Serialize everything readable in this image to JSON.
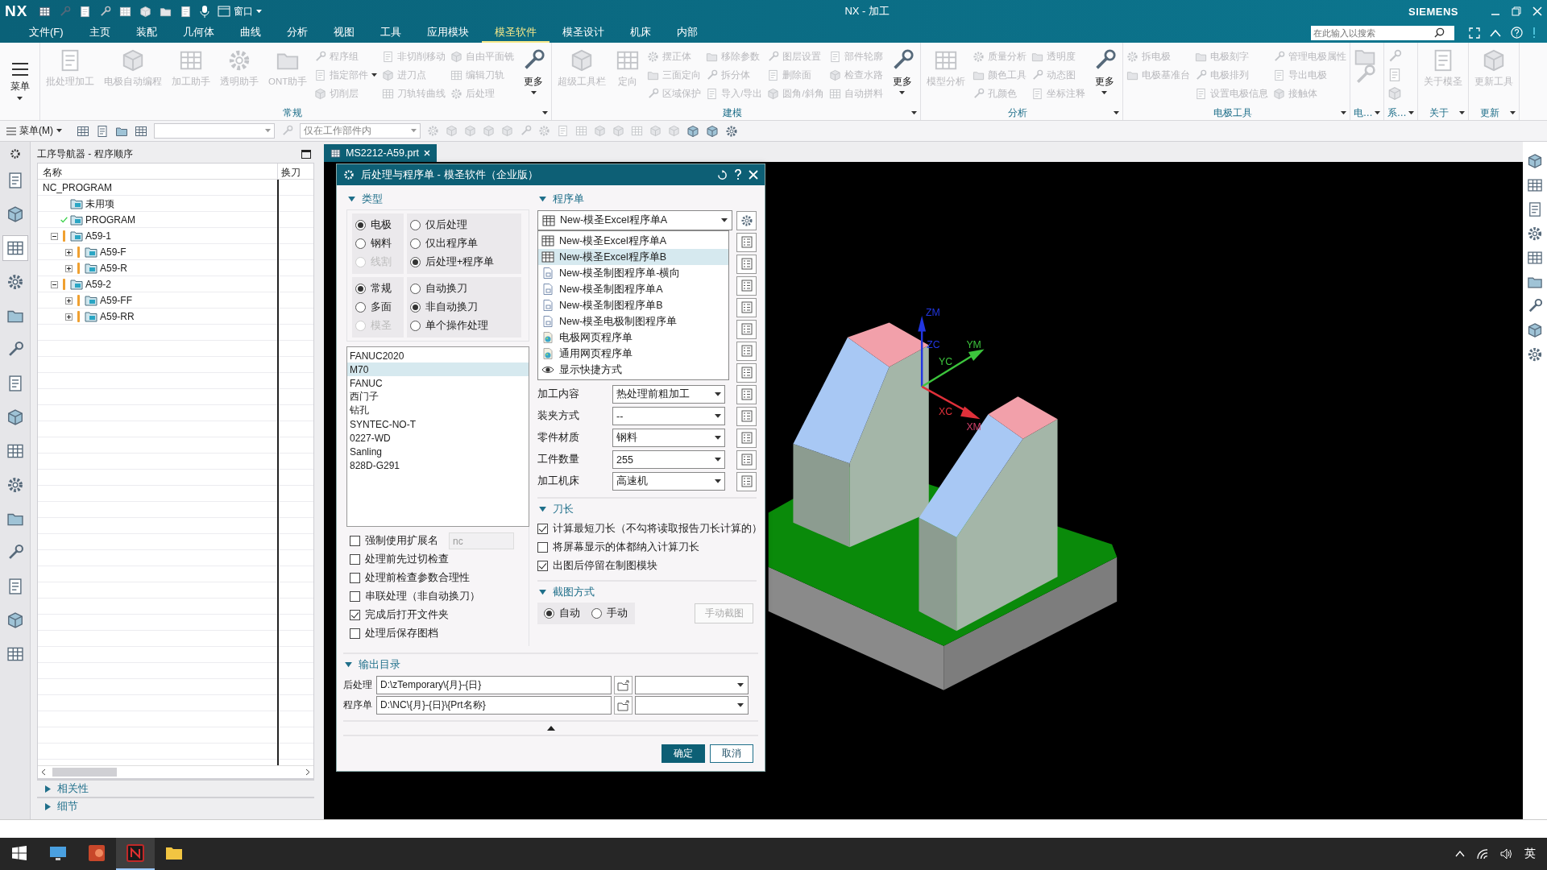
{
  "titlebar": {
    "logo": "NX",
    "window_menu": "窗口",
    "title": "NX - 加工",
    "brand": "SIEMENS"
  },
  "menu_tabs": [
    {
      "label": "文件(F)",
      "selected": false
    },
    {
      "label": "主页",
      "selected": false
    },
    {
      "label": "装配",
      "selected": false
    },
    {
      "label": "几何体",
      "selected": false
    },
    {
      "label": "曲线",
      "selected": false
    },
    {
      "label": "分析",
      "selected": false
    },
    {
      "label": "视图",
      "selected": false
    },
    {
      "label": "工具",
      "selected": false
    },
    {
      "label": "应用模块",
      "selected": false
    },
    {
      "label": "模圣软件",
      "selected": true
    },
    {
      "label": "模圣设计",
      "selected": false
    },
    {
      "label": "机床",
      "selected": false
    },
    {
      "label": "内部",
      "selected": false
    }
  ],
  "search": {
    "placeholder": "在此输入以搜索"
  },
  "ribbon": {
    "menu_button": "菜单",
    "groups": [
      {
        "label": "常规",
        "items": [
          {
            "kind": "large",
            "label": "批处理加工",
            "disabled": true
          },
          {
            "kind": "large",
            "label": "电极自动编程",
            "disabled": true
          },
          {
            "kind": "large",
            "label": "加工助手",
            "disabled": true
          },
          {
            "kind": "large",
            "label": "透明助手",
            "disabled": true
          },
          {
            "kind": "large",
            "label": "ONT助手",
            "disabled": true
          },
          {
            "kind": "column",
            "items": [
              {
                "label": "程序组",
                "disabled": true
              },
              {
                "label": "指定部件",
                "disabled": true,
                "menu": true
              },
              {
                "label": "切削层",
                "disabled": true
              }
            ]
          },
          {
            "kind": "column",
            "items": [
              {
                "label": "非切削移动",
                "disabled": true
              },
              {
                "label": "进刀点",
                "disabled": true
              },
              {
                "label": "刀轨转曲线",
                "disabled": true
              }
            ]
          },
          {
            "kind": "column",
            "items": [
              {
                "label": "自由平面铣",
                "disabled": true
              },
              {
                "label": "编辑刀轨",
                "disabled": true
              },
              {
                "label": "后处理",
                "disabled": true
              }
            ]
          },
          {
            "kind": "more",
            "label": "更多",
            "disabled": false
          }
        ]
      },
      {
        "label": "建模",
        "items": [
          {
            "kind": "large",
            "label": "超级工具栏",
            "disabled": true
          },
          {
            "kind": "large",
            "label": "定向",
            "disabled": true
          },
          {
            "kind": "column",
            "items": [
              {
                "label": "摆正体",
                "disabled": true
              },
              {
                "label": "三面定向",
                "disabled": true
              },
              {
                "label": "区域保护",
                "disabled": true
              }
            ]
          },
          {
            "kind": "column",
            "items": [
              {
                "label": "移除参数",
                "disabled": true
              },
              {
                "label": "拆分体",
                "disabled": true
              },
              {
                "label": "导入/导出",
                "disabled": true
              }
            ]
          },
          {
            "kind": "column",
            "items": [
              {
                "label": "图层设置",
                "disabled": true
              },
              {
                "label": "删除面",
                "disabled": true
              },
              {
                "label": "圆角/斜角",
                "disabled": true
              }
            ]
          },
          {
            "kind": "column",
            "items": [
              {
                "label": "部件轮廓",
                "disabled": true
              },
              {
                "label": "检查水路",
                "disabled": true
              },
              {
                "label": "自动拼料",
                "disabled": true
              }
            ]
          },
          {
            "kind": "more",
            "label": "更多",
            "disabled": false
          }
        ]
      },
      {
        "label": "分析",
        "items": [
          {
            "kind": "large",
            "label": "模型分析",
            "disabled": true
          },
          {
            "kind": "column",
            "items": [
              {
                "label": "质量分析",
                "disabled": true
              },
              {
                "label": "颜色工具",
                "disabled": true
              },
              {
                "label": "孔颜色",
                "disabled": true
              }
            ]
          },
          {
            "kind": "column",
            "items": [
              {
                "label": "透明度",
                "disabled": true
              },
              {
                "label": "动态图",
                "disabled": true
              },
              {
                "label": "坐标注释",
                "disabled": true
              }
            ]
          },
          {
            "kind": "more",
            "label": "更多",
            "disabled": false
          }
        ]
      },
      {
        "label": "电极工具",
        "items": [
          {
            "kind": "column",
            "items": [
              {
                "label": "拆电极",
                "disabled": true
              },
              {
                "label": "电极基准台",
                "disabled": true
              }
            ]
          },
          {
            "kind": "column",
            "items": [
              {
                "label": "电极刻字",
                "disabled": true
              },
              {
                "label": "电极排列",
                "disabled": true
              },
              {
                "label": "设置电极信息",
                "disabled": true
              }
            ]
          },
          {
            "kind": "column",
            "items": [
              {
                "label": "管理电极属性",
                "disabled": true
              },
              {
                "label": "导出电极",
                "disabled": true
              },
              {
                "label": "接触体",
                "disabled": true
              }
            ]
          }
        ]
      },
      {
        "label": "电…",
        "items": [
          {
            "kind": "icons",
            "items": [
              {
                "disabled": true
              },
              {
                "disabled": true
              }
            ]
          }
        ]
      },
      {
        "label": "系…",
        "items": [
          {
            "kind": "icons",
            "items": [
              {
                "disabled": true
              },
              {
                "disabled": true
              },
              {
                "disabled": true
              }
            ]
          }
        ]
      },
      {
        "label": "关于",
        "items": [
          {
            "kind": "large",
            "label": "关于模圣",
            "disabled": true
          }
        ]
      },
      {
        "label": "更新",
        "items": [
          {
            "kind": "large",
            "label": "更新工具",
            "disabled": true
          }
        ]
      }
    ]
  },
  "toolbar": {
    "menu": "菜单(M)",
    "scope": "仅在工作部件内"
  },
  "left_tabs": [
    {
      "selected": false
    },
    {
      "selected": false
    },
    {
      "selected": true
    },
    {
      "selected": false
    },
    {
      "selected": false
    },
    {
      "selected": false
    },
    {
      "selected": false
    },
    {
      "selected": false
    },
    {
      "selected": false
    },
    {
      "selected": false
    },
    {
      "selected": false
    },
    {
      "selected": false
    },
    {
      "selected": false
    },
    {
      "selected": false
    },
    {
      "selected": false
    }
  ],
  "navigator": {
    "title": "工序导航器 - 程序顺序",
    "columns": [
      "名称",
      "换刀"
    ],
    "tree": [
      {
        "label": "NC_PROGRAM",
        "children": [
          {
            "label": "未用项",
            "done": false,
            "warning": false
          },
          {
            "label": "PROGRAM",
            "done": true,
            "warning": false
          },
          {
            "label": "A59-1",
            "done": false,
            "warning": true,
            "expanded": true,
            "children": [
              {
                "label": "A59-F",
                "done": false,
                "warning": true,
                "expanded": false
              },
              {
                "label": "A59-R",
                "done": false,
                "warning": true,
                "expanded": false
              }
            ]
          },
          {
            "label": "A59-2",
            "done": false,
            "warning": true,
            "expanded": true,
            "children": [
              {
                "label": "A59-FF",
                "done": false,
                "warning": true,
                "expanded": false
              },
              {
                "label": "A59-RR",
                "done": false,
                "warning": true,
                "expanded": false
              }
            ]
          }
        ]
      }
    ],
    "sections": [
      {
        "label": "相关性",
        "expanded": false
      },
      {
        "label": "细节",
        "expanded": false
      }
    ]
  },
  "graphics": {
    "tab": "MS2212-A59.prt",
    "axes": [
      {
        "label": "ZM",
        "color": "#2236e0"
      },
      {
        "label": "ZC",
        "color": "#2236e0"
      },
      {
        "label": "YC",
        "color": "#3cc43c"
      },
      {
        "label": "YM",
        "color": "#3cc43c"
      },
      {
        "label": "XC",
        "color": "#e0303a"
      },
      {
        "label": "XM",
        "color": "#d0406a"
      }
    ]
  },
  "dialog": {
    "title": "后处理与程序单 - 模圣软件（企业版）",
    "type_section": {
      "label": "类型",
      "expanded": true,
      "groups": [
        {
          "options": [
            {
              "label": "电极",
              "selected": true,
              "disabled": false
            },
            {
              "label": "钢料",
              "selected": false,
              "disabled": false
            },
            {
              "label": "线割",
              "selected": false,
              "disabled": true
            }
          ]
        },
        {
          "options": [
            {
              "label": "仅后处理",
              "selected": false,
              "disabled": false
            },
            {
              "label": "仅出程序单",
              "selected": false,
              "disabled": false
            },
            {
              "label": "后处理+程序单",
              "selected": true,
              "disabled": false
            }
          ]
        },
        {
          "options": [
            {
              "label": "常规",
              "selected": true,
              "disabled": false
            },
            {
              "label": "多面",
              "selected": false,
              "disabled": false
            },
            {
              "label": "模圣",
              "selected": false,
              "disabled": true
            }
          ]
        },
        {
          "options": [
            {
              "label": "自动换刀",
              "selected": false,
              "disabled": false
            },
            {
              "label": "非自动换刀",
              "selected": true,
              "disabled": false
            },
            {
              "label": "单个操作处理",
              "selected": false,
              "disabled": false
            }
          ]
        }
      ]
    },
    "posts": [
      {
        "label": "FANUC2020",
        "selected": false
      },
      {
        "label": "M70",
        "selected": true
      },
      {
        "label": "FANUC",
        "selected": false
      },
      {
        "label": "西门子",
        "selected": false
      },
      {
        "label": "钻孔",
        "selected": false
      },
      {
        "label": "SYNTEC-NO-T",
        "selected": false
      },
      {
        "label": "0227-WD",
        "selected": false
      },
      {
        "label": "Sanling",
        "selected": false
      },
      {
        "label": "828D-G291",
        "selected": false
      }
    ],
    "left_checks": [
      {
        "label": "强制使用扩展名",
        "checked": false,
        "extension": "nc"
      },
      {
        "label": "处理前先过切检查",
        "checked": false
      },
      {
        "label": "处理前检查参数合理性",
        "checked": false
      },
      {
        "label": "串联处理（非自动换刀）",
        "checked": false
      },
      {
        "label": "完成后打开文件夹",
        "checked": true
      },
      {
        "label": "处理后保存图档",
        "checked": false
      }
    ],
    "program_section": {
      "label": "程序单",
      "expanded": true,
      "value": "New-模圣Excel程序单A",
      "options": [
        {
          "label": "New-模圣Excel程序单A",
          "kind": "excel",
          "highlighted": false
        },
        {
          "label": "New-模圣Excel程序单B",
          "kind": "excel",
          "highlighted": true
        },
        {
          "label": "New-模圣制图程序单-横向",
          "kind": "drawing",
          "highlighted": false
        },
        {
          "label": "New-模圣制图程序单A",
          "kind": "drawing",
          "highlighted": false
        },
        {
          "label": "New-模圣制图程序单B",
          "kind": "drawing",
          "highlighted": false
        },
        {
          "label": "New-模圣电极制图程序单",
          "kind": "drawing",
          "highlighted": false
        },
        {
          "label": "电极网页程序单",
          "kind": "web",
          "highlighted": false
        },
        {
          "label": "通用网页程序单",
          "kind": "web",
          "highlighted": false
        },
        {
          "label": "显示快捷方式",
          "kind": "eye",
          "highlighted": false
        }
      ],
      "fields": [
        {
          "label": "加工内容",
          "value": "热处理前粗加工"
        },
        {
          "label": "装夹方式",
          "value": "--"
        },
        {
          "label": "零件材质",
          "value": "钢料"
        },
        {
          "label": "工件数量",
          "value": "255"
        },
        {
          "label": "加工机床",
          "value": "高速机"
        }
      ]
    },
    "tool_length": {
      "label": "刀长",
      "expanded": true,
      "checks": [
        {
          "label": "计算最短刀长（不勾将读取报告刀长计算的）",
          "checked": true
        },
        {
          "label": "将屏幕显示的体都纳入计算刀长",
          "checked": false
        },
        {
          "label": "出图后停留在制图模块",
          "checked": true
        }
      ]
    },
    "capture": {
      "label": "截图方式",
      "expanded": true,
      "options": [
        {
          "label": "自动",
          "selected": true
        },
        {
          "label": "手动",
          "selected": false
        }
      ],
      "button": {
        "label": "手动截图",
        "disabled": true
      }
    },
    "output": {
      "label": "输出目录",
      "expanded": true,
      "rows": [
        {
          "label": "后处理",
          "value": "D:\\zTemporary\\{月}-{日}"
        },
        {
          "label": "程序单",
          "value": "D:\\NC\\{月}-{日}\\{Prt名称}"
        }
      ]
    },
    "buttons": [
      {
        "label": "确定",
        "kind": "primary"
      },
      {
        "label": "取消",
        "kind": "secondary"
      }
    ]
  },
  "taskbar": {
    "apps": [
      {
        "kind": "desktop",
        "selected": false
      },
      {
        "kind": "slides",
        "selected": false
      },
      {
        "kind": "cad",
        "selected": true
      },
      {
        "kind": "folder",
        "selected": false
      }
    ],
    "language": "英"
  }
}
